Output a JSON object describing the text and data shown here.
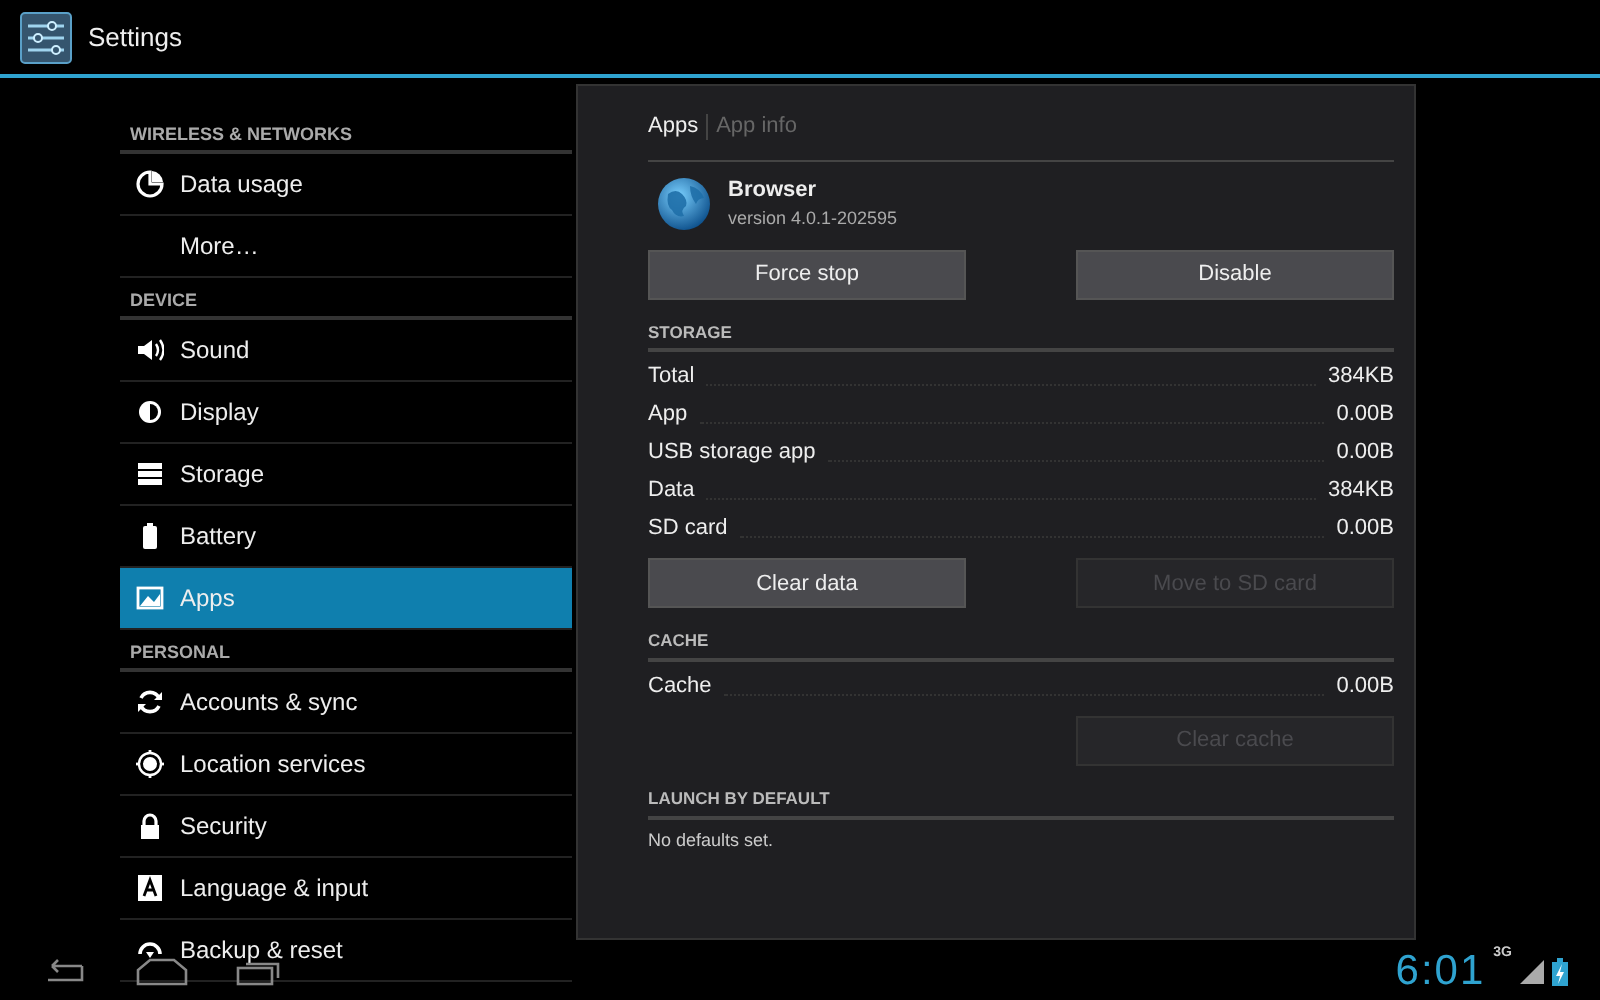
{
  "action_bar": {
    "title": "Settings"
  },
  "sidebar": {
    "items": [
      {
        "kind": "header",
        "label": "WIRELESS & NETWORKS"
      },
      {
        "kind": "item",
        "label": "Data usage",
        "selected": false
      },
      {
        "kind": "item",
        "label": "More…",
        "selected": false
      },
      {
        "kind": "header",
        "label": "DEVICE"
      },
      {
        "kind": "item",
        "label": "Sound",
        "selected": false
      },
      {
        "kind": "item",
        "label": "Display",
        "selected": false
      },
      {
        "kind": "item",
        "label": "Storage",
        "selected": false
      },
      {
        "kind": "item",
        "label": "Battery",
        "selected": false
      },
      {
        "kind": "item",
        "label": "Apps",
        "selected": true
      },
      {
        "kind": "header",
        "label": "PERSONAL"
      },
      {
        "kind": "item",
        "label": "Accounts & sync",
        "selected": false
      },
      {
        "kind": "item",
        "label": "Location services",
        "selected": false
      },
      {
        "kind": "item",
        "label": "Security",
        "selected": false
      },
      {
        "kind": "item",
        "label": "Language & input",
        "selected": false
      },
      {
        "kind": "item",
        "label": "Backup & reset",
        "selected": false
      }
    ]
  },
  "detail": {
    "breadcrumbs": [
      {
        "label": "Apps",
        "selected": true
      },
      {
        "label": "App info",
        "selected": false
      }
    ],
    "app": {
      "name": "Browser",
      "version": "version 4.0.1-202595"
    },
    "buttons": [
      {
        "label": "Force stop",
        "disabled": false
      },
      {
        "label": "Disable",
        "disabled": false
      }
    ],
    "sections": [
      {
        "heading": "STORAGE",
        "rows": [
          {
            "label": "Total",
            "value": "384KB"
          },
          {
            "label": "App",
            "value": "0.00B"
          },
          {
            "label": "USB storage app",
            "value": "0.00B"
          },
          {
            "label": "Data",
            "value": "384KB"
          },
          {
            "label": "SD card",
            "value": "0.00B"
          }
        ],
        "buttons": [
          {
            "label": "Clear data",
            "disabled": false
          },
          {
            "label": "Move to SD card",
            "disabled": true
          }
        ]
      },
      {
        "heading": "CACHE",
        "rows": [
          {
            "label": "Cache",
            "value": "0.00B"
          }
        ],
        "buttons": [
          {
            "label": "Clear cache",
            "disabled": true
          }
        ]
      },
      {
        "heading": "LAUNCH BY DEFAULT",
        "text": "No defaults set."
      }
    ]
  },
  "status_bar": {
    "time": "6:01",
    "network": "3G"
  }
}
